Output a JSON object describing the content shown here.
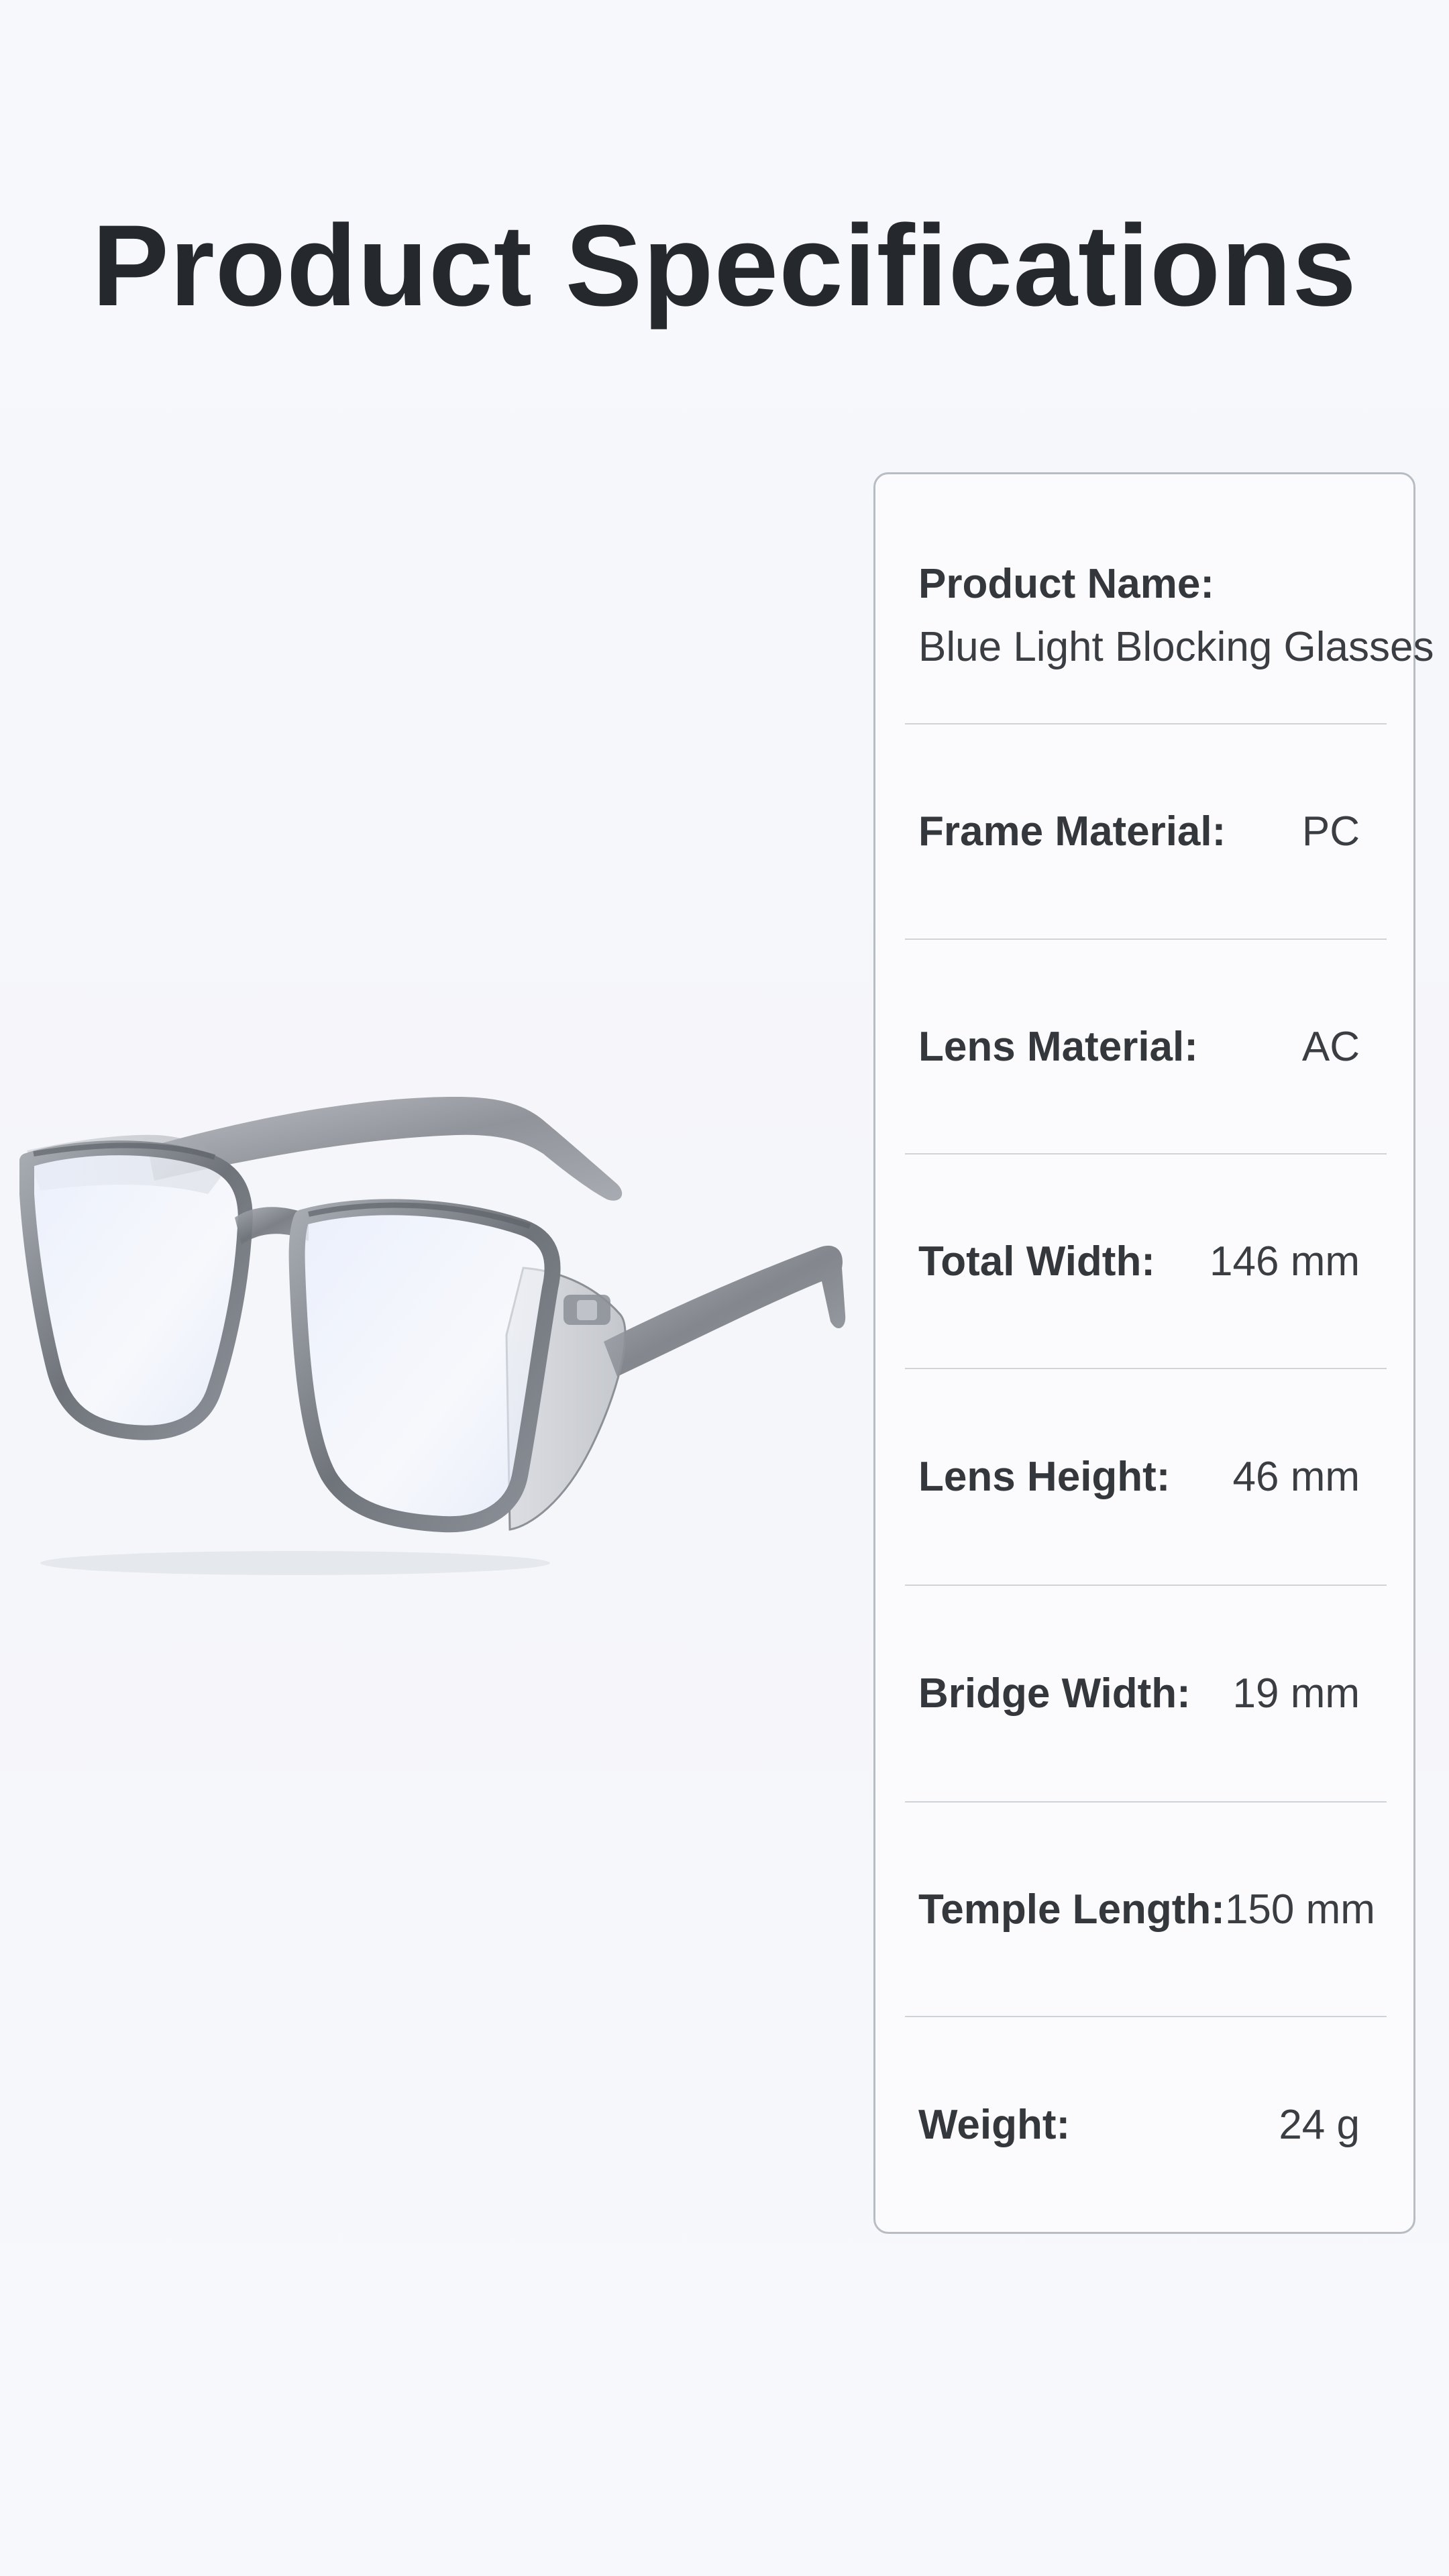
{
  "page": {
    "title": "Product Specifications"
  },
  "product_image": {
    "icon": "glasses-icon",
    "frame_color": "#7c8088",
    "lens_tint": "#dde6f7"
  },
  "specs": {
    "product_name": {
      "label": "Product Name:",
      "value": "Blue Light Blocking Glasses"
    },
    "frame_material": {
      "label": "Frame Material:",
      "value": "PC"
    },
    "lens_material": {
      "label": "Lens Material:",
      "value": "AC"
    },
    "total_width": {
      "label": "Total Width:",
      "value": "146 mm"
    },
    "lens_height": {
      "label": "Lens Height:",
      "value": "46 mm"
    },
    "bridge_width": {
      "label": "Bridge Width:",
      "value": "19 mm"
    },
    "temple_length": {
      "label": "Temple Length:",
      "value": "150 mm"
    },
    "weight": {
      "label": "Weight:",
      "value": "24 g"
    }
  }
}
